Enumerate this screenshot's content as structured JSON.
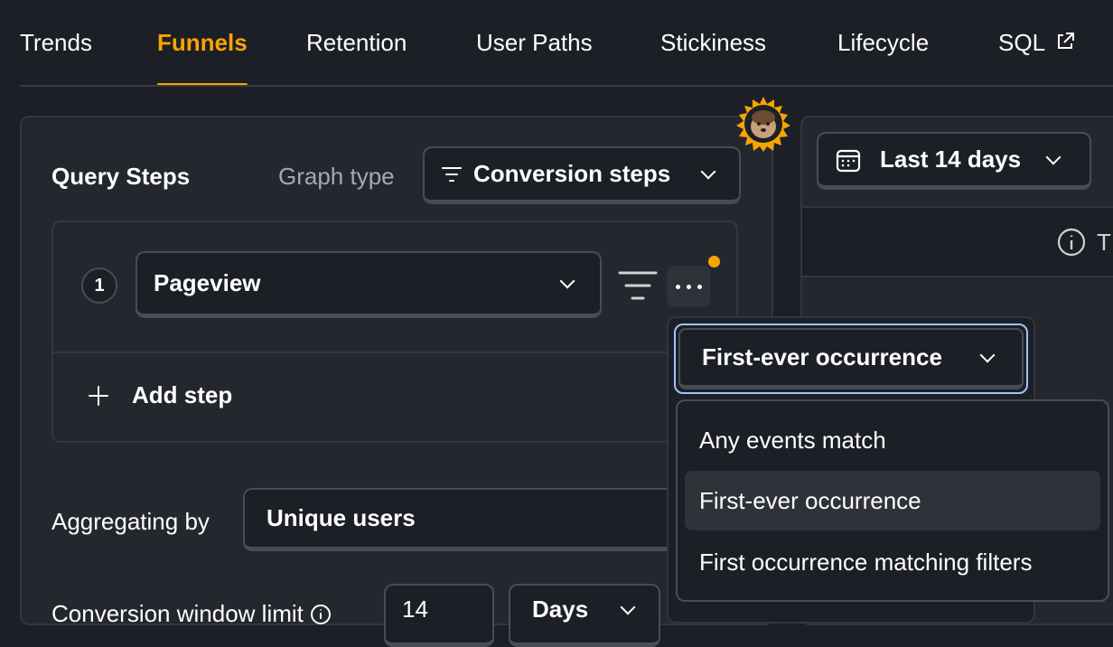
{
  "tabs": [
    "Trends",
    "Funnels",
    "Retention",
    "User Paths",
    "Stickiness",
    "Lifecycle",
    "SQL"
  ],
  "active_tab": "Funnels",
  "query": {
    "title": "Query Steps",
    "graph_type_label": "Graph type",
    "graph_type_value": "Conversion steps",
    "step_number": "1",
    "step_event": "Pageview",
    "add_step_label": "Add step",
    "aggregating_label": "Aggregating by",
    "aggregating_value": "Unique users",
    "conversion_label": "Conversion window limit",
    "conversion_value": "14",
    "conversion_unit": "Days"
  },
  "date_range": {
    "value": "Last 14 days"
  },
  "right_info_text": "T",
  "step_filter": {
    "selected": "First-ever occurrence",
    "options": [
      "Any events match",
      "First-ever occurrence",
      "First occurrence matching filters"
    ]
  },
  "colors": {
    "accent": "#f7a501",
    "background": "#1d1f27",
    "panel": "#25272f",
    "focus": "#9dc3ff"
  },
  "icons": [
    "filter-icon",
    "chevron-down-icon",
    "calendar-icon",
    "info-icon",
    "plus-icon",
    "more-icon",
    "external-link-icon",
    "hedgehog-avatar"
  ]
}
